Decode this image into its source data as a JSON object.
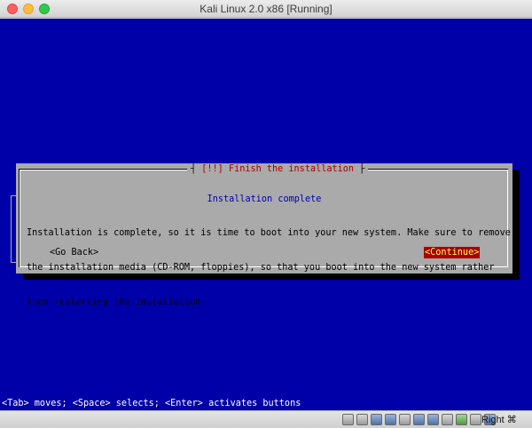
{
  "window": {
    "title": "Kali Linux 2.0 x86 [Running]"
  },
  "dialog": {
    "title": "[!!] Finish the installation",
    "subtitle": "Installation complete",
    "body_lines": [
      "Installation is complete, so it is time to boot into your new system. Make sure to remove",
      "the installation media (CD-ROM, floppies), so that you boot into the new system rather",
      "than restarting the installation."
    ],
    "go_back_label": "<Go Back>",
    "continue_label": "<Continue>",
    "colors": {
      "screen_bg": "#0000a8",
      "dialog_bg": "#aaaaaa",
      "title_fg": "#a80000",
      "selected_button_bg": "#a80000",
      "selected_button_fg": "#ffff55"
    }
  },
  "status_line": "<Tab> moves; <Space> selects; <Enter> activates buttons",
  "vbox_statusbar": {
    "icons": [
      "optical-drive-icon",
      "audio-icon",
      "usb-icon",
      "shared-folders-icon",
      "display-icon",
      "network-icon",
      "recording-icon",
      "mouse-integration-icon",
      "cpu-icon",
      "guest-additions-icon",
      "host-key-arrow-icon"
    ],
    "host_key": "Right ⌘"
  }
}
